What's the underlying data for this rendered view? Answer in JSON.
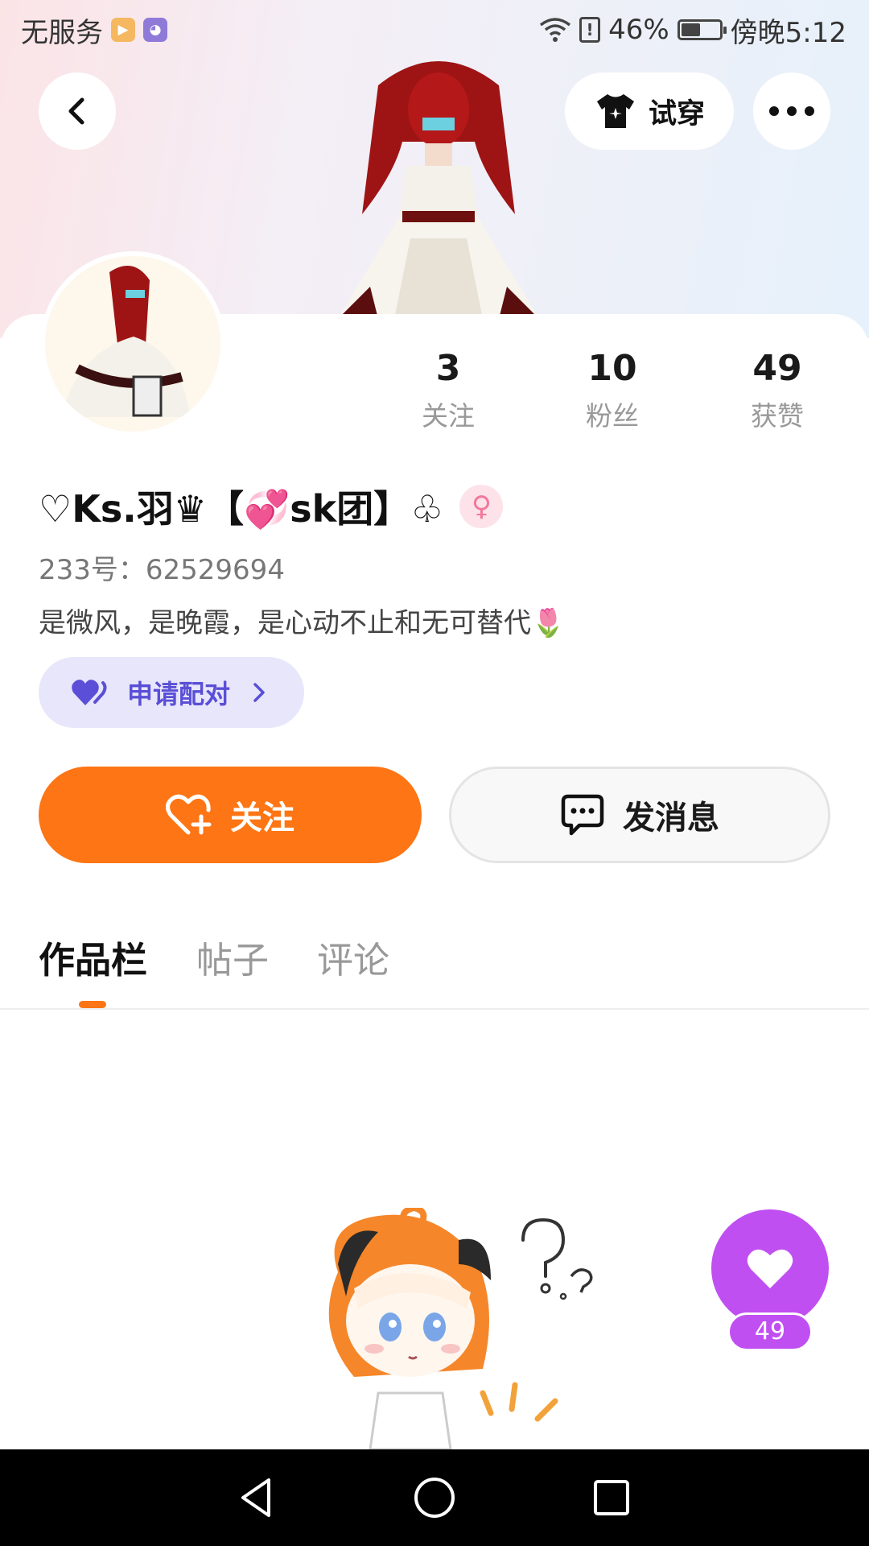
{
  "status_bar": {
    "carrier": "无服务",
    "battery_percent": "46%",
    "battery_level": 0.46,
    "time": "傍晚5:12",
    "icons": [
      "video-app-icon",
      "purple-app-icon",
      "wifi-icon",
      "alert-icon",
      "battery-icon"
    ]
  },
  "header": {
    "tryon_label": "试穿"
  },
  "profile": {
    "stats": [
      {
        "value": "3",
        "label": "关注"
      },
      {
        "value": "10",
        "label": "粉丝"
      },
      {
        "value": "49",
        "label": "获赞"
      }
    ],
    "username": "♡Ks.羽♛【💞sk团】♧",
    "gender_symbol": "♀",
    "id_line": "233号：62529694",
    "bio": "是微风，是晚霞，是心动不止和无可替代🌷",
    "pair_label": "申请配对"
  },
  "actions": {
    "follow_label": "关注",
    "message_label": "发消息",
    "follow_color": "#fd7514"
  },
  "tabs": [
    {
      "label": "作品栏",
      "active": true
    },
    {
      "label": "帖子",
      "active": false
    },
    {
      "label": "评论",
      "active": false
    }
  ],
  "like_fab": {
    "count": "49",
    "color": "#c04ff2"
  }
}
